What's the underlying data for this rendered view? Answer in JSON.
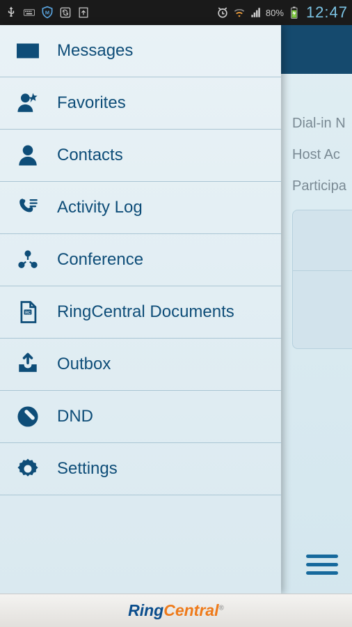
{
  "status_bar": {
    "battery_percent": "80%",
    "time": "12:47"
  },
  "background": {
    "lines": [
      "Dial-in N",
      "Host Ac",
      "Participa"
    ]
  },
  "menu": {
    "items": [
      {
        "icon": "envelope",
        "label": "Messages"
      },
      {
        "icon": "favorite",
        "label": "Favorites"
      },
      {
        "icon": "contact",
        "label": "Contacts"
      },
      {
        "icon": "activity",
        "label": "Activity Log"
      },
      {
        "icon": "conference",
        "label": "Conference"
      },
      {
        "icon": "document",
        "label": "RingCentral Documents"
      },
      {
        "icon": "outbox",
        "label": "Outbox"
      },
      {
        "icon": "dnd",
        "label": "DND"
      },
      {
        "icon": "settings",
        "label": "Settings"
      }
    ]
  },
  "footer": {
    "logo_part1": "Ring",
    "logo_part2": "Central"
  }
}
